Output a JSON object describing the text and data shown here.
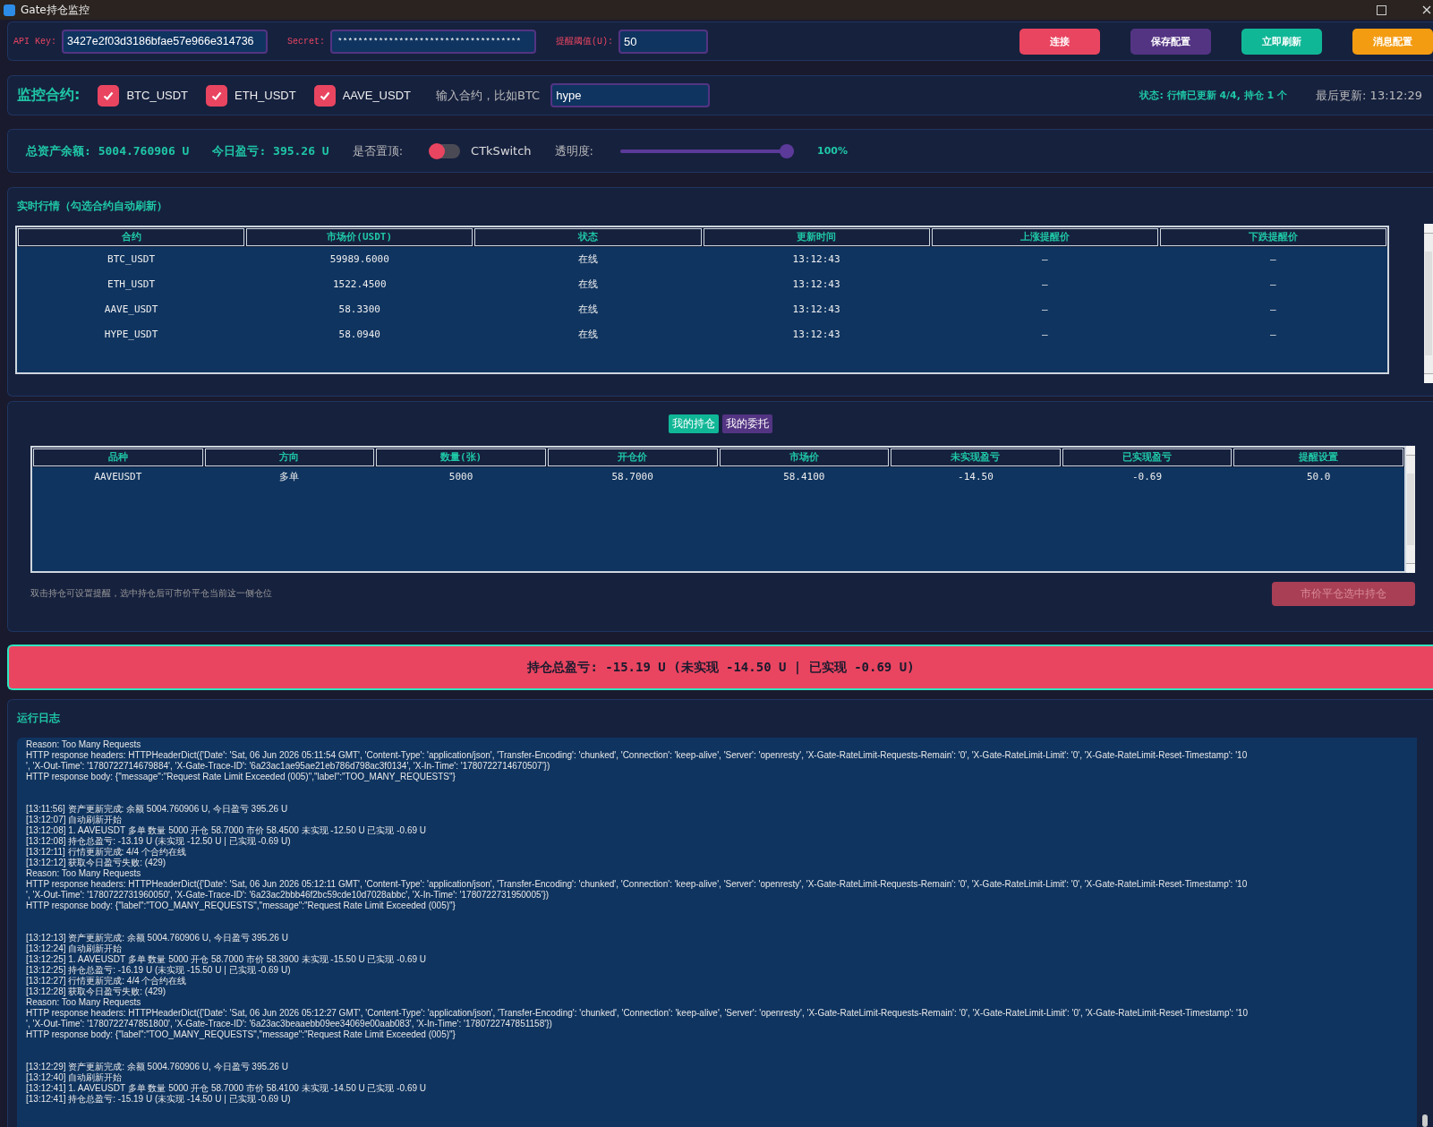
{
  "window": {
    "title": "Gate持仓监控"
  },
  "config": {
    "fields": [
      {
        "label": "API Key:",
        "value": "3427e2f03d3186bfae57e966e314736",
        "kind": "text"
      },
      {
        "label": "Secret:",
        "value": "************************************",
        "kind": "secret"
      },
      {
        "label": "提醒阈值(U):",
        "value": "50",
        "kind": "short"
      }
    ],
    "buttons": [
      {
        "label": "连接",
        "color": "#e94560"
      },
      {
        "label": "保存配置",
        "color": "#533483"
      },
      {
        "label": "立即刷新",
        "color": "#10b797"
      },
      {
        "label": "消息配置",
        "color": "#f39c12"
      }
    ]
  },
  "monitor": {
    "label": "监控合约:",
    "contracts": [
      {
        "label": "BTC_USDT",
        "checked": true
      },
      {
        "label": "ETH_USDT",
        "checked": true
      },
      {
        "label": "AAVE_USDT",
        "checked": true
      }
    ],
    "input_label": "输入合约，比如BTC",
    "input_value": "hype",
    "status": "状态: 行情已更新 4/4, 持仓 1 个",
    "last_update": "最后更新: 13:12:29"
  },
  "assets": {
    "balance": "总资产余额: 5004.760906 U",
    "today_pnl": "今日盈亏: 395.26 U",
    "pin_label": "是否置顶:",
    "switch": {
      "label": "CTkSwitch",
      "on": false
    },
    "opacity_label": "透明度:",
    "opacity": {
      "level": 1,
      "reading": "100%"
    }
  },
  "market": {
    "title": "实时行情（勾选合约自动刷新）",
    "columns": [
      "合约",
      "市场价(USDT)",
      "状态",
      "更新时间",
      "上涨提醒价",
      "下跌提醒价"
    ],
    "rows": [
      [
        "BTC_USDT",
        "59989.6000",
        "在线",
        "13:12:43",
        "—",
        "—"
      ],
      [
        "ETH_USDT",
        "1522.4500",
        "在线",
        "13:12:43",
        "—",
        "—"
      ],
      [
        "AAVE_USDT",
        "58.3300",
        "在线",
        "13:12:43",
        "—",
        "—"
      ],
      [
        "HYPE_USDT",
        "58.0940",
        "在线",
        "13:12:43",
        "—",
        "—"
      ]
    ]
  },
  "positions": {
    "tabs": [
      {
        "label": "我的持仓",
        "selected": true
      },
      {
        "label": "我的委托",
        "selected": false
      }
    ],
    "columns": [
      "品种",
      "方向",
      "数量(张)",
      "开仓价",
      "市场价",
      "未实现盈亏",
      "已实现盈亏",
      "提醒设置"
    ],
    "rows": [
      [
        "AAVEUSDT",
        "多单",
        "5000",
        "58.7000",
        "58.4100",
        "-14.50",
        "-0.69",
        "50.0"
      ]
    ],
    "hint": "双击持仓可设置提醒，选中持仓后可市价平仓当前这一侧仓位",
    "close_button": {
      "label": "市价平仓选中持仓",
      "disabled": true
    }
  },
  "total": "持仓总盈亏: -15.19 U (未实现 -14.50 U | 已实现 -0.69 U)",
  "log": {
    "title": "运行日志",
    "groups": [
      [
        "Reason: Too Many Requests",
        "HTTP response headers: HTTPHeaderDict({'Date': 'Sat, 06 Jun 2026 05:11:54 GMT', 'Content-Type': 'application/json', 'Transfer-Encoding': 'chunked', 'Connection': 'keep-alive', 'Server': 'openresty', 'X-Gate-RateLimit-Requests-Remain': '0', 'X-Gate-RateLimit-Limit': '0', 'X-Gate-RateLimit-Reset-Timestamp': '10",
        "', 'X-Out-Time': '1780722714679884', 'X-Gate-Trace-ID': '6a23ac1ae95ae21eb786d798ac3f0134', 'X-In-Time': '1780722714670507'})",
        "HTTP response body: {\"message\":\"Request Rate Limit Exceeded (005)\",\"label\":\"TOO_MANY_REQUESTS\"}"
      ],
      [
        "[13:11:56] 资产更新完成: 余额 5004.760906 U, 今日盈亏 395.26 U",
        "[13:12:07] 自动刷新开始",
        "[13:12:08] 1. AAVEUSDT 多单 数量 5000 开仓 58.7000 市价 58.4500 未实现 -12.50 U 已实现 -0.69 U",
        "[13:12:08] 持仓总盈亏: -13.19 U (未实现 -12.50 U | 已实现 -0.69 U)",
        "[13:12:11] 行情更新完成: 4/4 个合约在线",
        "[13:12:12] 获取今日盈亏失败: (429)",
        "Reason: Too Many Requests",
        "HTTP response headers: HTTPHeaderDict({'Date': 'Sat, 06 Jun 2026 05:12:11 GMT', 'Content-Type': 'application/json', 'Transfer-Encoding': 'chunked', 'Connection': 'keep-alive', 'Server': 'openresty', 'X-Gate-RateLimit-Requests-Remain': '0', 'X-Gate-RateLimit-Limit': '0', 'X-Gate-RateLimit-Reset-Timestamp': '10",
        "', 'X-Out-Time': '1780722731960050', 'X-Gate-Trace-ID': '6a23ac2bbb46f2bc59cde10d7028abbc', 'X-In-Time': '1780722731950005'})",
        "HTTP response body: {\"label\":\"TOO_MANY_REQUESTS\",\"message\":\"Request Rate Limit Exceeded (005)\"}"
      ],
      [
        "[13:12:13] 资产更新完成: 余额 5004.760906 U, 今日盈亏 395.26 U",
        "[13:12:24] 自动刷新开始",
        "[13:12:25] 1. AAVEUSDT 多单 数量 5000 开仓 58.7000 市价 58.3900 未实现 -15.50 U 已实现 -0.69 U",
        "[13:12:25] 持仓总盈亏: -16.19 U (未实现 -15.50 U | 已实现 -0.69 U)",
        "[13:12:27] 行情更新完成: 4/4 个合约在线",
        "[13:12:28] 获取今日盈亏失败: (429)",
        "Reason: Too Many Requests",
        "HTTP response headers: HTTPHeaderDict({'Date': 'Sat, 06 Jun 2026 05:12:27 GMT', 'Content-Type': 'application/json', 'Transfer-Encoding': 'chunked', 'Connection': 'keep-alive', 'Server': 'openresty', 'X-Gate-RateLimit-Requests-Remain': '0', 'X-Gate-RateLimit-Limit': '0', 'X-Gate-RateLimit-Reset-Timestamp': '10",
        "', 'X-Out-Time': '1780722747851800', 'X-Gate-Trace-ID': '6a23ac3beaaebb09ee34069e00aab083', 'X-In-Time': '1780722747851158'})",
        "HTTP response body: {\"label\":\"TOO_MANY_REQUESTS\",\"message\":\"Request Rate Limit Exceeded (005)\"}"
      ],
      [
        "[13:12:29] 资产更新完成: 余额 5004.760906 U, 今日盈亏 395.26 U",
        "[13:12:40] 自动刷新开始",
        "[13:12:41] 1. AAVEUSDT 多单 数量 5000 开仓 58.7000 市价 58.4100 未实现 -14.50 U 已实现 -0.69 U",
        "[13:12:41] 持仓总盈亏: -15.19 U (未实现 -14.50 U | 已实现 -0.69 U)"
      ]
    ]
  }
}
